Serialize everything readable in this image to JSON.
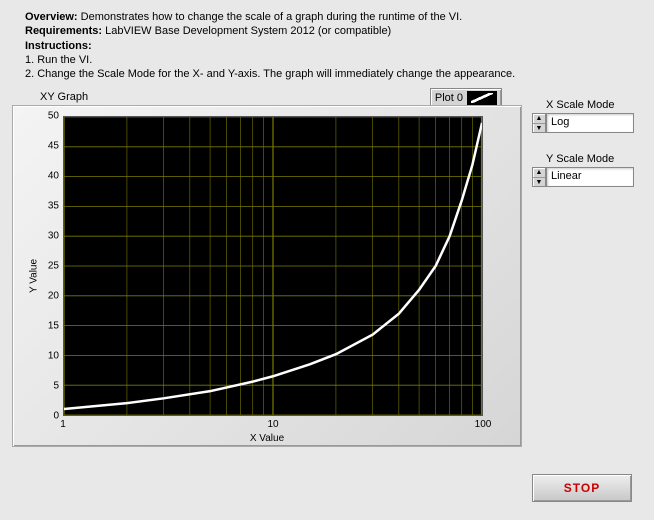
{
  "header": {
    "overview_label": "Overview:",
    "overview_text": " Demonstrates how to change the scale of a graph during the runtime of the VI.",
    "requirements_label": "Requirements:",
    "requirements_text": " LabVIEW Base Development System 2012 (or compatible)",
    "instructions_label": "Instructions:",
    "step1": "1. Run the VI.",
    "step2": "2. Change the Scale Mode for the X- and Y-axis. The graph will immediately change the appearance."
  },
  "graph": {
    "title": "XY Graph",
    "legend_label": "Plot 0",
    "xlabel": "X Value",
    "ylabel": "Y Value"
  },
  "controls": {
    "x_mode_label": "X Scale Mode",
    "x_mode_value": "Log",
    "y_mode_label": "Y Scale Mode",
    "y_mode_value": "Linear",
    "stop_label": "STOP"
  },
  "chart_data": {
    "type": "line",
    "title": "XY Graph",
    "xlabel": "X Value",
    "ylabel": "Y Value",
    "x_scale": "log",
    "y_scale": "linear",
    "xlim": [
      1,
      100
    ],
    "ylim": [
      0,
      50
    ],
    "x_ticks": [
      1,
      10,
      100
    ],
    "y_ticks": [
      0,
      5,
      10,
      15,
      20,
      25,
      30,
      35,
      40,
      45,
      50
    ],
    "series": [
      {
        "name": "Plot 0",
        "color": "#ffffff",
        "x": [
          1,
          2,
          3,
          5,
          8,
          10,
          15,
          20,
          30,
          40,
          50,
          60,
          70,
          80,
          90,
          100
        ],
        "y": [
          1,
          2,
          2.8,
          4,
          5.6,
          6.5,
          8.5,
          10.2,
          13.5,
          17,
          21,
          25,
          30,
          36,
          42,
          49
        ]
      }
    ]
  }
}
